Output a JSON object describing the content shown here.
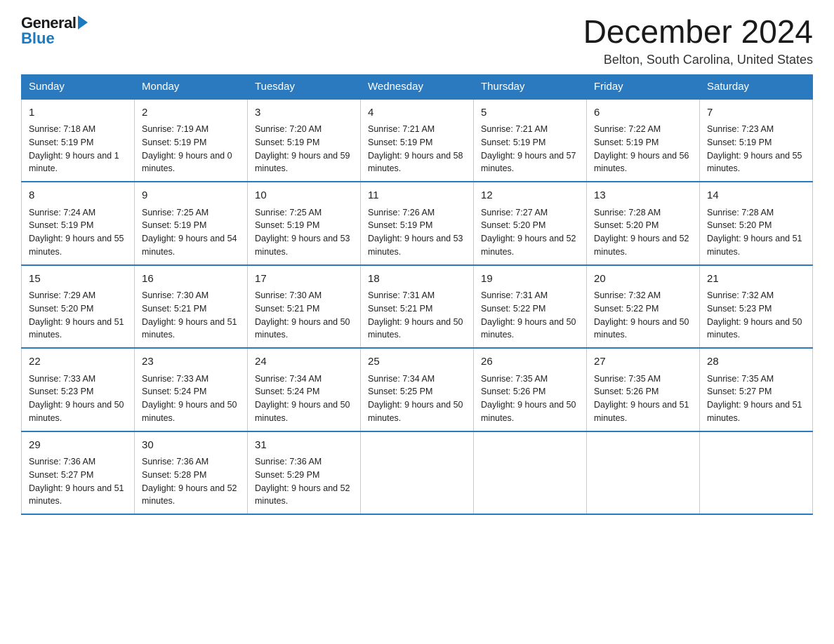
{
  "header": {
    "logo_general": "General",
    "logo_blue": "Blue",
    "month_title": "December 2024",
    "location": "Belton, South Carolina, United States"
  },
  "weekdays": [
    "Sunday",
    "Monday",
    "Tuesday",
    "Wednesday",
    "Thursday",
    "Friday",
    "Saturday"
  ],
  "weeks": [
    [
      {
        "day": "1",
        "sunrise": "7:18 AM",
        "sunset": "5:19 PM",
        "daylight": "9 hours and 1 minute."
      },
      {
        "day": "2",
        "sunrise": "7:19 AM",
        "sunset": "5:19 PM",
        "daylight": "9 hours and 0 minutes."
      },
      {
        "day": "3",
        "sunrise": "7:20 AM",
        "sunset": "5:19 PM",
        "daylight": "9 hours and 59 minutes."
      },
      {
        "day": "4",
        "sunrise": "7:21 AM",
        "sunset": "5:19 PM",
        "daylight": "9 hours and 58 minutes."
      },
      {
        "day": "5",
        "sunrise": "7:21 AM",
        "sunset": "5:19 PM",
        "daylight": "9 hours and 57 minutes."
      },
      {
        "day": "6",
        "sunrise": "7:22 AM",
        "sunset": "5:19 PM",
        "daylight": "9 hours and 56 minutes."
      },
      {
        "day": "7",
        "sunrise": "7:23 AM",
        "sunset": "5:19 PM",
        "daylight": "9 hours and 55 minutes."
      }
    ],
    [
      {
        "day": "8",
        "sunrise": "7:24 AM",
        "sunset": "5:19 PM",
        "daylight": "9 hours and 55 minutes."
      },
      {
        "day": "9",
        "sunrise": "7:25 AM",
        "sunset": "5:19 PM",
        "daylight": "9 hours and 54 minutes."
      },
      {
        "day": "10",
        "sunrise": "7:25 AM",
        "sunset": "5:19 PM",
        "daylight": "9 hours and 53 minutes."
      },
      {
        "day": "11",
        "sunrise": "7:26 AM",
        "sunset": "5:19 PM",
        "daylight": "9 hours and 53 minutes."
      },
      {
        "day": "12",
        "sunrise": "7:27 AM",
        "sunset": "5:20 PM",
        "daylight": "9 hours and 52 minutes."
      },
      {
        "day": "13",
        "sunrise": "7:28 AM",
        "sunset": "5:20 PM",
        "daylight": "9 hours and 52 minutes."
      },
      {
        "day": "14",
        "sunrise": "7:28 AM",
        "sunset": "5:20 PM",
        "daylight": "9 hours and 51 minutes."
      }
    ],
    [
      {
        "day": "15",
        "sunrise": "7:29 AM",
        "sunset": "5:20 PM",
        "daylight": "9 hours and 51 minutes."
      },
      {
        "day": "16",
        "sunrise": "7:30 AM",
        "sunset": "5:21 PM",
        "daylight": "9 hours and 51 minutes."
      },
      {
        "day": "17",
        "sunrise": "7:30 AM",
        "sunset": "5:21 PM",
        "daylight": "9 hours and 50 minutes."
      },
      {
        "day": "18",
        "sunrise": "7:31 AM",
        "sunset": "5:21 PM",
        "daylight": "9 hours and 50 minutes."
      },
      {
        "day": "19",
        "sunrise": "7:31 AM",
        "sunset": "5:22 PM",
        "daylight": "9 hours and 50 minutes."
      },
      {
        "day": "20",
        "sunrise": "7:32 AM",
        "sunset": "5:22 PM",
        "daylight": "9 hours and 50 minutes."
      },
      {
        "day": "21",
        "sunrise": "7:32 AM",
        "sunset": "5:23 PM",
        "daylight": "9 hours and 50 minutes."
      }
    ],
    [
      {
        "day": "22",
        "sunrise": "7:33 AM",
        "sunset": "5:23 PM",
        "daylight": "9 hours and 50 minutes."
      },
      {
        "day": "23",
        "sunrise": "7:33 AM",
        "sunset": "5:24 PM",
        "daylight": "9 hours and 50 minutes."
      },
      {
        "day": "24",
        "sunrise": "7:34 AM",
        "sunset": "5:24 PM",
        "daylight": "9 hours and 50 minutes."
      },
      {
        "day": "25",
        "sunrise": "7:34 AM",
        "sunset": "5:25 PM",
        "daylight": "9 hours and 50 minutes."
      },
      {
        "day": "26",
        "sunrise": "7:35 AM",
        "sunset": "5:26 PM",
        "daylight": "9 hours and 50 minutes."
      },
      {
        "day": "27",
        "sunrise": "7:35 AM",
        "sunset": "5:26 PM",
        "daylight": "9 hours and 51 minutes."
      },
      {
        "day": "28",
        "sunrise": "7:35 AM",
        "sunset": "5:27 PM",
        "daylight": "9 hours and 51 minutes."
      }
    ],
    [
      {
        "day": "29",
        "sunrise": "7:36 AM",
        "sunset": "5:27 PM",
        "daylight": "9 hours and 51 minutes."
      },
      {
        "day": "30",
        "sunrise": "7:36 AM",
        "sunset": "5:28 PM",
        "daylight": "9 hours and 52 minutes."
      },
      {
        "day": "31",
        "sunrise": "7:36 AM",
        "sunset": "5:29 PM",
        "daylight": "9 hours and 52 minutes."
      },
      null,
      null,
      null,
      null
    ]
  ],
  "daylight_label": "Daylight: ",
  "sunrise_label": "Sunrise: ",
  "sunset_label": "Sunset: "
}
